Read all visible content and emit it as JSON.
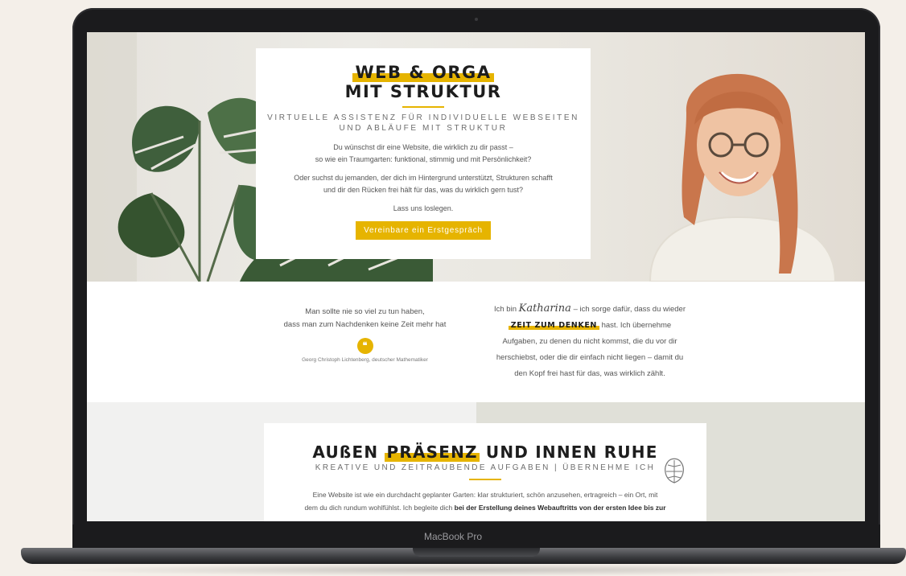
{
  "laptop": {
    "model_label": "MacBook Pro"
  },
  "hero": {
    "title_line1": "WEB & ORGA",
    "title_line2": "MIT STRUKTUR",
    "subtitle_line1": "VIRTUELLE ASSISTENZ FÜR INDIVIDUELLE WEBSEITEN",
    "subtitle_line2": "UND ABLÄUFE MIT STRUKTUR",
    "para1_line1": "Du wünschst dir eine Website, die wirklich zu dir passt –",
    "para1_line2": "so wie ein Traumgarten: funktional, stimmig und mit Persönlichkeit?",
    "para2_line1": "Oder suchst du jemanden, der dich im Hintergrund unterstützt, Strukturen schafft",
    "para2_line2": "und dir den Rücken frei hält für das, was du wirklich gern tust?",
    "para3": "Lass uns loslegen.",
    "cta_label": "Vereinbare ein Erstgespräch"
  },
  "quote": {
    "line1": "Man sollte nie so viel zu tun haben,",
    "line2": "dass man zum Nachdenken keine Zeit mehr hat",
    "mark": "❝",
    "author": "Georg Christoph Lichtenberg, deutscher Mathematiker"
  },
  "intro": {
    "prefix": "Ich bin",
    "signature": "Katharina",
    "after_signature": "– ich sorge dafür, dass du wieder",
    "keyword": "ZEIT ZUM DENKEN",
    "after_keyword": "hast. Ich übernehme",
    "line3": "Aufgaben, zu denen du nicht kommst, die du vor dir",
    "line4": "herschiebst, oder die dir einfach nicht liegen – damit du",
    "line5": "den Kopf frei hast für das, was wirklich zählt."
  },
  "section2": {
    "title_part1": "AUßEN",
    "title_highlight": "PRÄSENZ",
    "title_part2": "UND INNEN RUHE",
    "subtitle": "KREATIVE UND ZEITRAUBENDE AUFGABEN | ÜBERNEHME ICH",
    "body_line1": "Eine Website ist wie ein durchdacht geplanter Garten: klar strukturiert, schön anzusehen, ertragreich – ein Ort, mit",
    "body_line2_plain": "dem du dich rundum wohlfühlst. Ich begleite dich",
    "body_line2_bold": "bei der Erstellung deines Webauftritts von der ersten Idee bis zur"
  },
  "colors": {
    "accent": "#e6b400",
    "dark": "#1d1d1d",
    "bezel": "#1b1b1d"
  }
}
